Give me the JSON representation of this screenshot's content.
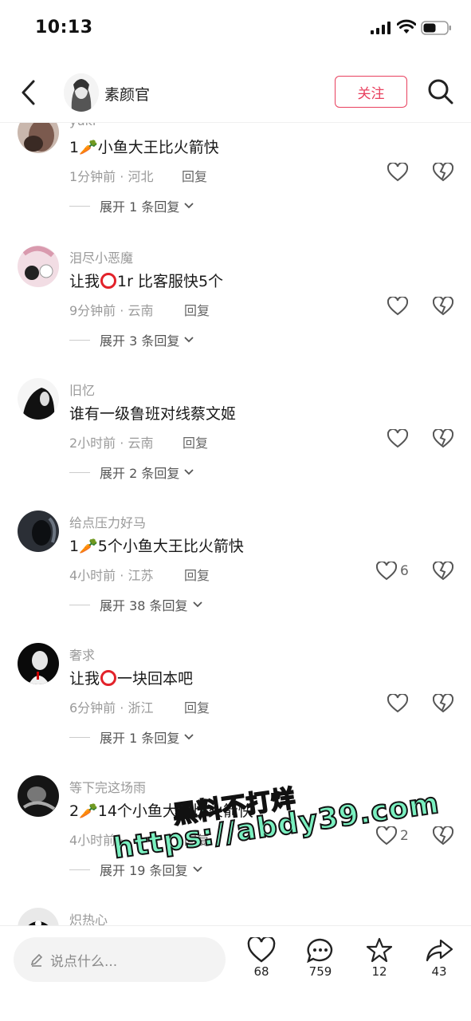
{
  "status_bar": {
    "time": "10:13"
  },
  "header": {
    "title": "素颜官",
    "follow_label": "关注"
  },
  "comments": [
    {
      "user": "yuki",
      "text": "1🥕小鱼大王比火箭快",
      "meta": "1分钟前 · 河北",
      "reply": "回复",
      "likes": "",
      "expand": "展开 1 条回复"
    },
    {
      "user": "泪尽小恶魔",
      "text_pre": "让我",
      "text_post": "1r  比客服快5个",
      "meta": "9分钟前 · 云南",
      "reply": "回复",
      "likes": "",
      "expand": "展开 3 条回复"
    },
    {
      "user": "旧忆",
      "text": "谁有一级鲁班对线蔡文姬",
      "meta": "2小时前 · 云南",
      "reply": "回复",
      "likes": "",
      "expand": "展开 2 条回复"
    },
    {
      "user": "给点压力好马",
      "text": "1🥕5个小鱼大王比火箭快",
      "meta": "4小时前 · 江苏",
      "reply": "回复",
      "likes": "6",
      "expand": "展开 38 条回复"
    },
    {
      "user": "奢求",
      "text_pre": "让我",
      "text_post": "一块回本吧",
      "meta": "6分钟前 · 浙江",
      "reply": "回复",
      "likes": "",
      "expand": "展开 1 条回复"
    },
    {
      "user": "等下完这场雨",
      "text": "2🥕14个小鱼大王比火箭快",
      "meta": "4小时前 · ",
      "reply": "回复",
      "likes": "2",
      "expand": "展开 19 条回复"
    },
    {
      "user": "炽热心"
    }
  ],
  "bottom_bar": {
    "input_placeholder": "说点什么...",
    "likes": "68",
    "comments": "759",
    "favorites": "12",
    "shares": "43"
  },
  "watermark": {
    "line1": "黑料不打烊",
    "line2": "https://abdy39.com"
  },
  "colors": {
    "accent": "#e8405e",
    "muted": "#9a9a9a"
  }
}
